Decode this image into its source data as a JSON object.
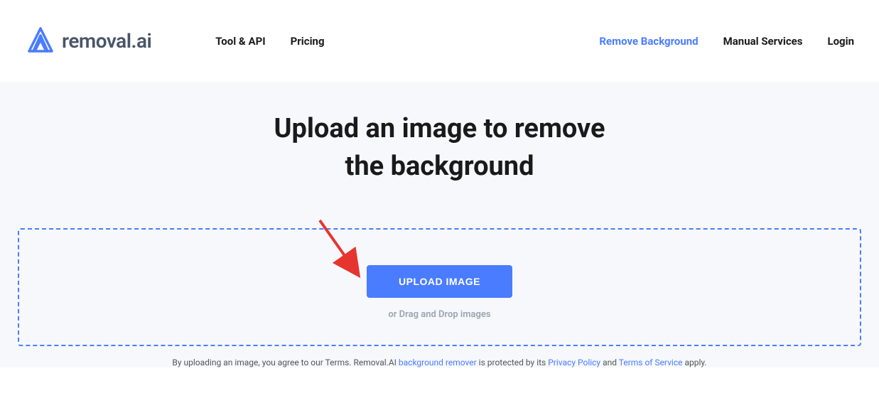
{
  "logo": {
    "text": "removal.ai"
  },
  "nav": {
    "left": [
      {
        "label": "Tool & API"
      },
      {
        "label": "Pricing"
      }
    ],
    "right": [
      {
        "label": "Remove Background",
        "active": true
      },
      {
        "label": "Manual Services",
        "active": false
      },
      {
        "label": "Login",
        "active": false
      }
    ]
  },
  "main": {
    "heading_line1": "Upload an image to remove",
    "heading_line2": "the background",
    "upload_button": "UPLOAD IMAGE",
    "drag_text": "or Drag and Drop images"
  },
  "terms": {
    "prefix": "By uploading an image, you agree to our Terms. Removal.AI ",
    "link1": "background remover",
    "middle1": " is protected by its ",
    "link2": "Privacy Policy",
    "middle2": " and ",
    "link3": "Terms of Service",
    "suffix": " apply."
  }
}
